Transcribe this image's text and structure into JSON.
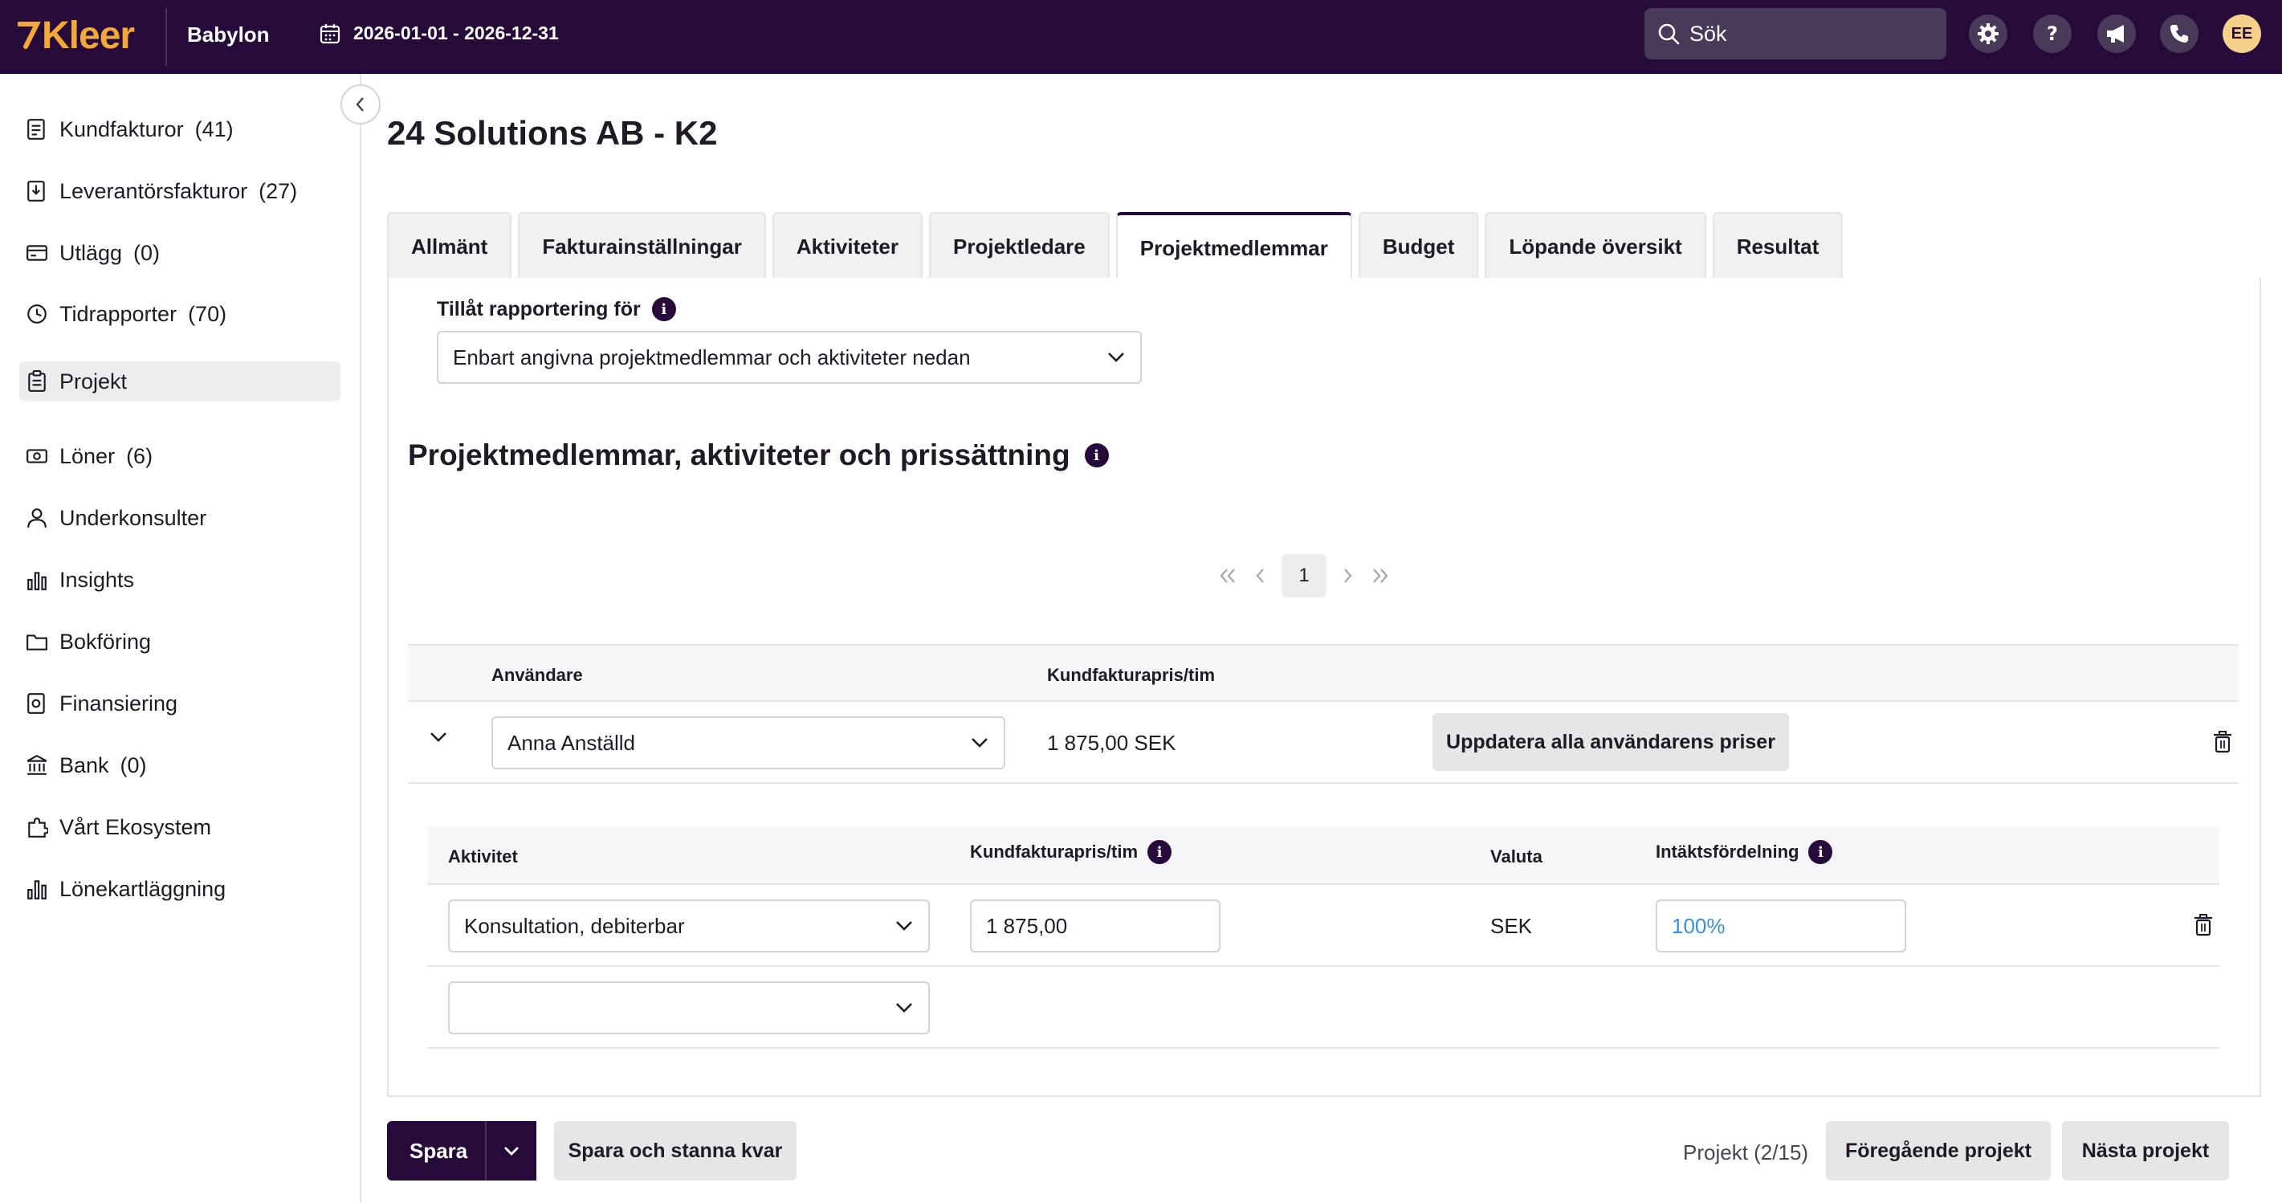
{
  "topbar": {
    "logo": "Kleer",
    "company": "Babylon",
    "date_range": "2026-01-01 - 2026-12-31",
    "search_placeholder": "Sök",
    "avatar": "EE",
    "icons": [
      "gear-icon",
      "help-icon",
      "megaphone-icon",
      "phone-icon"
    ]
  },
  "sidebar": {
    "items": [
      {
        "label": "Kundfakturor",
        "count": "(41)",
        "icon": "invoice-icon"
      },
      {
        "label": "Leverantörsfakturor",
        "count": "(27)",
        "icon": "supplier-invoice-icon"
      },
      {
        "label": "Utlägg",
        "count": "(0)",
        "icon": "card-icon"
      },
      {
        "label": "Tidrapporter",
        "count": "(70)",
        "icon": "clock-icon"
      },
      {
        "label": "Projekt",
        "count": "",
        "icon": "clipboard-icon",
        "active": true
      },
      {
        "label": "Löner",
        "count": "(6)",
        "icon": "money-icon"
      },
      {
        "label": "Underkonsulter",
        "count": "",
        "icon": "person-icon"
      },
      {
        "label": "Insights",
        "count": "",
        "icon": "bar-chart-icon"
      },
      {
        "label": "Bokföring",
        "count": "",
        "icon": "folder-icon"
      },
      {
        "label": "Finansiering",
        "count": "",
        "icon": "finance-icon"
      },
      {
        "label": "Bank",
        "count": "(0)",
        "icon": "bank-icon"
      },
      {
        "label": "Vårt Ekosystem",
        "count": "",
        "icon": "puzzle-icon"
      },
      {
        "label": "Lönekartläggning",
        "count": "",
        "icon": "chart-icon"
      }
    ]
  },
  "main": {
    "title": "24 Solutions AB - K2",
    "tabs": [
      "Allmänt",
      "Fakturainställningar",
      "Aktiviteter",
      "Projektledare",
      "Projektmedlemmar",
      "Budget",
      "Löpande översikt",
      "Resultat"
    ],
    "active_tab": "Projektmedlemmar",
    "reporting_label": "Tillåt rapportering för",
    "reporting_value": "Enbart angivna projektmedlemmar och aktiviteter nedan",
    "section_title": "Projektmedlemmar, aktiviteter och prissättning",
    "pager_page": "1",
    "table": {
      "col_user": "Användare",
      "col_price": "Kundfakturapris/tim",
      "user": "Anna Anställd",
      "user_price": "1 875,00 SEK",
      "update_button": "Uppdatera alla användarens priser"
    },
    "subtable": {
      "col_activity": "Aktivitet",
      "col_price": "Kundfakturapris/tim",
      "col_currency": "Valuta",
      "col_revenue": "Intäktsfördelning",
      "activity": "Konsultation, debiterbar",
      "price": "1 875,00",
      "currency": "SEK",
      "revenue": "100%",
      "empty_activity": ""
    }
  },
  "footer": {
    "save": "Spara",
    "save_stay": "Spara och stanna kvar",
    "project_counter": "Projekt (2/15)",
    "prev": "Föregående projekt",
    "next": "Nästa projekt"
  },
  "colors": {
    "brand_dark": "#250a3a",
    "logo_accent": "#f2a83b",
    "link_blue": "#3a8fd6"
  }
}
